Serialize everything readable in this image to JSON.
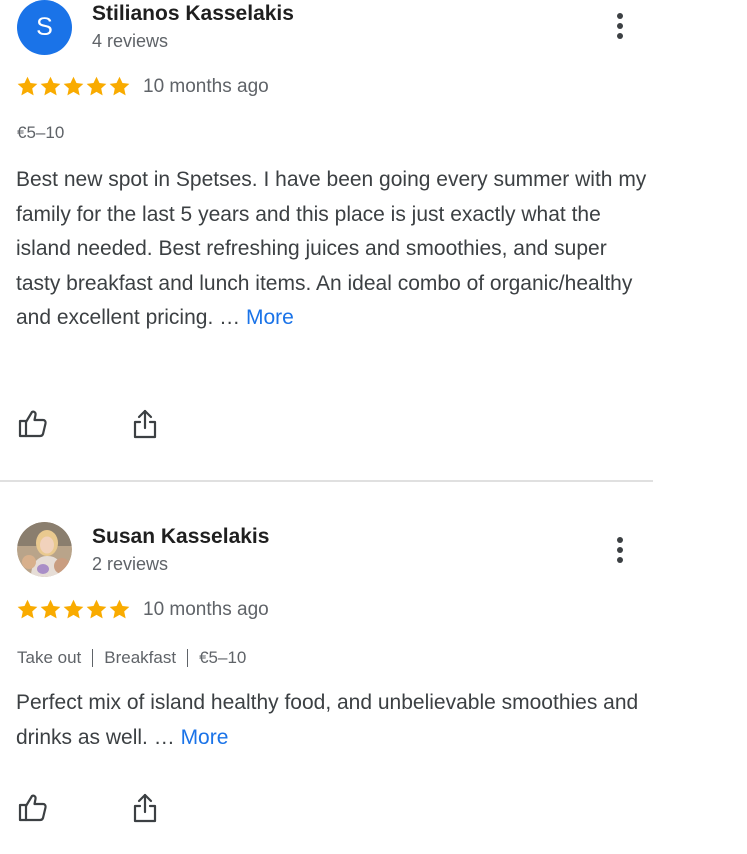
{
  "reviews": [
    {
      "avatar_letter": "S",
      "author": "Stilianos Kasselakis",
      "review_count": "4 reviews",
      "rating": 5,
      "rating_max": 5,
      "date": "10 months ago",
      "meta": {
        "price": "€5–10"
      },
      "text": "Best new spot in Spetses. I have been going every summer with my family for the last 5 years and this place is just exactly what the island needed. Best refreshing juices and smoothies, and super tasty breakfast and lunch items. An ideal combo of organic/healthy and excellent pricing. …",
      "more_label": "More"
    },
    {
      "author": "Susan Kasselakis",
      "review_count": "2 reviews",
      "rating": 5,
      "rating_max": 5,
      "date": "10 months ago",
      "meta": {
        "service": "Take out",
        "meal": "Breakfast",
        "price": "€5–10"
      },
      "text": "Perfect mix of island healthy food, and unbelievable smoothies and drinks as well. …",
      "more_label": "More"
    }
  ],
  "colors": {
    "star": "#f9ab00",
    "link": "#1a73e8",
    "avatar_bg": "#1a73e8"
  },
  "icons": [
    "more-vert-icon",
    "star-icon",
    "thumbs-up-icon",
    "share-icon"
  ]
}
